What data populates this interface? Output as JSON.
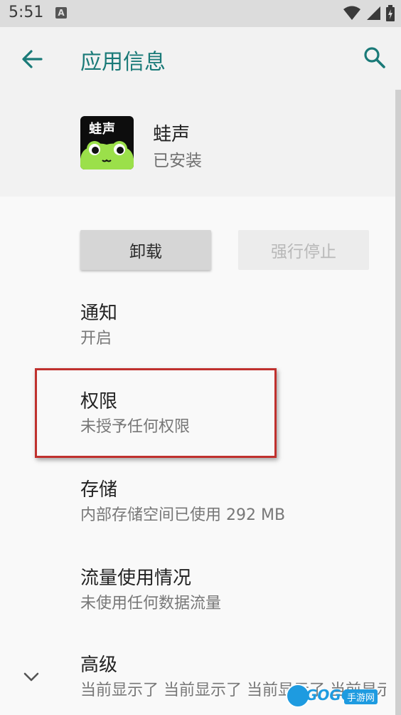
{
  "status_bar": {
    "time": "5:51",
    "notification_icon_letter": "A"
  },
  "app_bar": {
    "title": "应用信息",
    "accent_color": "#1a7a78"
  },
  "app": {
    "name": "蛙声",
    "status": "已安装",
    "icon_text": "蛙声"
  },
  "buttons": {
    "uninstall": "卸载",
    "force_stop": "强行停止"
  },
  "items": [
    {
      "title": "通知",
      "subtitle": "开启"
    },
    {
      "title": "权限",
      "subtitle": "未授予任何权限"
    },
    {
      "title": "存储",
      "subtitle": "内部存储空间已使用 292 MB"
    },
    {
      "title": "流量使用情况",
      "subtitle": "未使用任何数据流量"
    },
    {
      "title": "高级",
      "subtitle": "当前显示了 当前显示了 当前显示了 当前显示了"
    }
  ],
  "watermark": {
    "text": "GOGO",
    "tag": "手游网"
  },
  "colors": {
    "highlight": "#c0312e"
  }
}
